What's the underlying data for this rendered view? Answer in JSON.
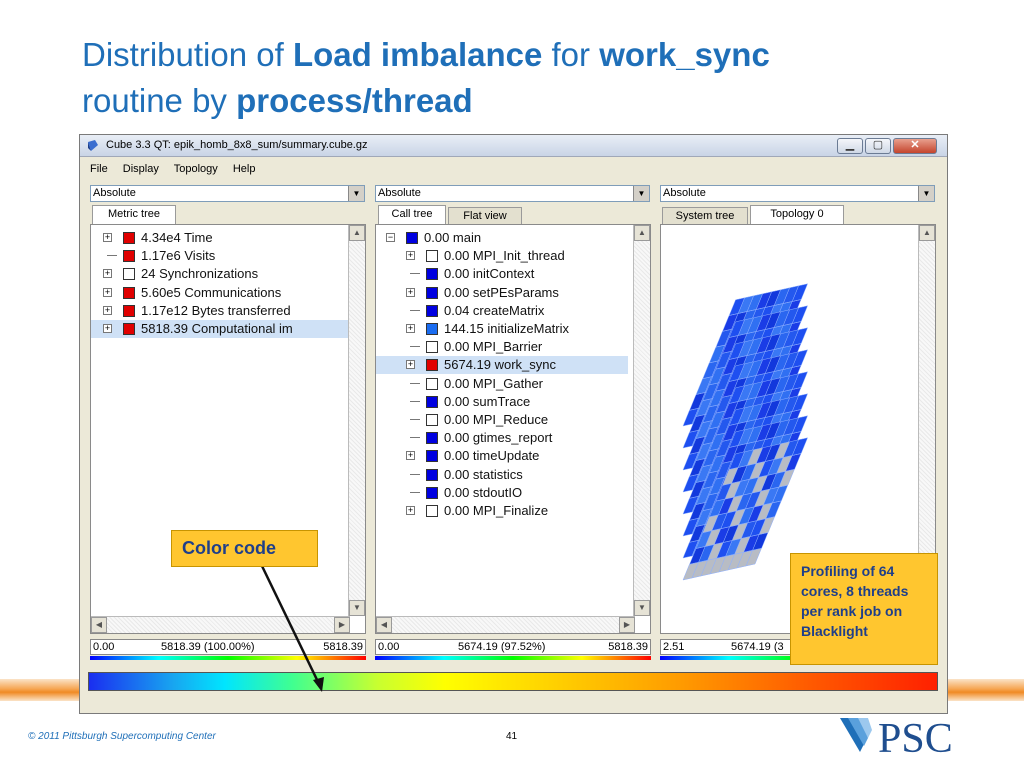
{
  "slide": {
    "title_part1": "Distribution of ",
    "title_bold1": "Load imbalance",
    "title_part2": " for ",
    "title_bold2": "work_sync",
    "title_line2": "routine by ",
    "title_bold3": "process/thread",
    "footer": "© 2011 Pittsburgh Supercomputing Center",
    "page_number": "41",
    "logo_text": "PSC",
    "callout_color": "Color code",
    "callout_profiling": "Profiling of 64 cores, 8 threads per rank job on Blacklight"
  },
  "window": {
    "title": "Cube 3.3 QT: epik_homb_8x8_sum/summary.cube.gz",
    "menu": [
      "File",
      "Display",
      "Topology",
      "Help"
    ]
  },
  "colors": {
    "accent": "#1f6fb8",
    "callout_bg": "#ffc62f",
    "callout_text": "#1f3f8a",
    "square_red": "#e00000",
    "square_blue": "#0000e0",
    "selection": "#cfe1f6"
  },
  "metric_panel": {
    "select_value": "Absolute",
    "tabs": [
      "Metric tree"
    ],
    "items": [
      {
        "label": "4.34e4 Time",
        "color": "#e00000",
        "expander": true
      },
      {
        "label": "1.17e6 Visits",
        "color": "#e00000",
        "expander": false
      },
      {
        "label": "24 Synchronizations",
        "color": "",
        "expander": true
      },
      {
        "label": "5.60e5 Communications",
        "color": "#e00000",
        "expander": true
      },
      {
        "label": "1.17e12 Bytes transferred",
        "color": "#e00000",
        "expander": true
      },
      {
        "label": "5818.39 Computational im",
        "color": "#e00000",
        "expander": true,
        "selected": true
      }
    ],
    "legend_min": "0.00",
    "legend_mid": "5818.39 (100.00%)",
    "legend_max": "5818.39"
  },
  "call_panel": {
    "select_value": "Absolute",
    "tabs": [
      "Call tree",
      "Flat view"
    ],
    "items": [
      {
        "label": "0.00 main",
        "color": "#0000e0",
        "expander": true,
        "indent": 0
      },
      {
        "label": "0.00 MPI_Init_thread",
        "color": "#ffffff",
        "expander": true,
        "indent": 1
      },
      {
        "label": "0.00 initContext",
        "color": "#0000e0",
        "expander": false,
        "indent": 1
      },
      {
        "label": "0.00 setPEsParams",
        "color": "#0000e0",
        "expander": true,
        "indent": 1
      },
      {
        "label": "0.04 createMatrix",
        "color": "#0000e0",
        "expander": false,
        "indent": 1
      },
      {
        "label": "144.15 initializeMatrix",
        "color": "#1a6cf0",
        "expander": true,
        "indent": 1
      },
      {
        "label": "0.00 MPI_Barrier",
        "color": "#ffffff",
        "expander": false,
        "indent": 1
      },
      {
        "label": "5674.19 work_sync",
        "color": "#e00000",
        "expander": true,
        "indent": 1,
        "selected": true
      },
      {
        "label": "0.00 MPI_Gather",
        "color": "#ffffff",
        "expander": false,
        "indent": 1
      },
      {
        "label": "0.00 sumTrace",
        "color": "#0000e0",
        "expander": false,
        "indent": 1
      },
      {
        "label": "0.00 MPI_Reduce",
        "color": "#ffffff",
        "expander": false,
        "indent": 1
      },
      {
        "label": "0.00 gtimes_report",
        "color": "#0000e0",
        "expander": false,
        "indent": 1
      },
      {
        "label": "0.00 timeUpdate",
        "color": "#0000e0",
        "expander": true,
        "indent": 1
      },
      {
        "label": "0.00 statistics",
        "color": "#0000e0",
        "expander": false,
        "indent": 1
      },
      {
        "label": "0.00 stdoutIO",
        "color": "#0000e0",
        "expander": false,
        "indent": 1
      },
      {
        "label": "0.00 MPI_Finalize",
        "color": "#ffffff",
        "expander": true,
        "indent": 1
      }
    ],
    "legend_min": "0.00",
    "legend_mid": "5674.19 (97.52%)",
    "legend_max": "5818.39"
  },
  "system_panel": {
    "select_value": "Absolute",
    "tabs": [
      "System tree",
      "Topology 0"
    ],
    "legend_min": "2.51",
    "legend_mid": "5674.19 (3"
  }
}
